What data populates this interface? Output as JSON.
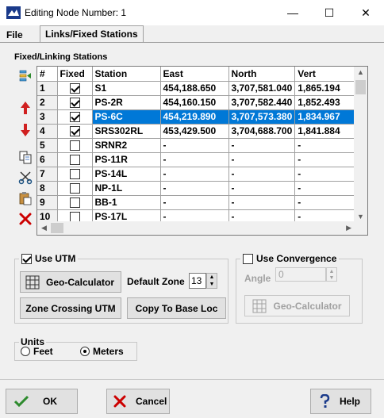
{
  "window": {
    "title": "Editing Node Number: 1",
    "minimize": "—",
    "maximize": "☐",
    "close": "✕"
  },
  "tabs": [
    {
      "label": "File",
      "active": false
    },
    {
      "label": "Links/Fixed Stations",
      "active": true
    }
  ],
  "stations": {
    "group_label": "Fixed/Linking Stations",
    "columns": [
      "#",
      "Fixed",
      "Station",
      "East",
      "North",
      "Vert"
    ],
    "rows": [
      {
        "num": "1",
        "fixed": true,
        "station": "S1",
        "east": "454,188.650",
        "north": "3,707,581.040",
        "vert": "1,865.194",
        "selected": false
      },
      {
        "num": "2",
        "fixed": true,
        "station": "PS-2R",
        "east": "454,160.150",
        "north": "3,707,582.440",
        "vert": "1,852.493",
        "selected": false
      },
      {
        "num": "3",
        "fixed": true,
        "station": "PS-6C",
        "east": "454,219.890",
        "north": "3,707,573.380",
        "vert": "1,834.967",
        "selected": true
      },
      {
        "num": "4",
        "fixed": true,
        "station": "SRS302RL",
        "east": "453,429.500",
        "north": "3,704,688.700",
        "vert": "1,841.884",
        "selected": false
      },
      {
        "num": "5",
        "fixed": false,
        "station": "SRNR2",
        "east": "-",
        "north": "-",
        "vert": "-",
        "selected": false
      },
      {
        "num": "6",
        "fixed": false,
        "station": "PS-11R",
        "east": "-",
        "north": "-",
        "vert": "-",
        "selected": false
      },
      {
        "num": "7",
        "fixed": false,
        "station": "PS-14L",
        "east": "-",
        "north": "-",
        "vert": "-",
        "selected": false
      },
      {
        "num": "8",
        "fixed": false,
        "station": "NP-1L",
        "east": "-",
        "north": "-",
        "vert": "-",
        "selected": false
      },
      {
        "num": "9",
        "fixed": false,
        "station": "BB-1",
        "east": "-",
        "north": "-",
        "vert": "-",
        "selected": false
      },
      {
        "num": "10",
        "fixed": false,
        "station": "PS-17L",
        "east": "-",
        "north": "-",
        "vert": "-",
        "selected": false
      }
    ]
  },
  "utm": {
    "checkbox_label": "Use UTM",
    "checked": true,
    "geo_calc_label": "Geo-Calculator",
    "default_zone_label": "Default Zone",
    "default_zone_value": "13",
    "zone_crossing_label": "Zone Crossing UTM",
    "copy_base_label": "Copy To Base Loc"
  },
  "convergence": {
    "checkbox_label": "Use Convergence",
    "checked": false,
    "angle_label": "Angle",
    "angle_value": "0",
    "geo_calc_label": "Geo-Calculator"
  },
  "units": {
    "group_label": "Units",
    "options": [
      {
        "label": "Feet",
        "selected": false
      },
      {
        "label": "Meters",
        "selected": true
      }
    ]
  },
  "footer": {
    "ok_label": "OK",
    "cancel_label": "Cancel",
    "help_label": "Help"
  },
  "colors": {
    "selection": "#0078d7",
    "ok_check": "#2e8b2e",
    "cancel_x": "#cc0000",
    "delete_x": "#cc0000"
  }
}
